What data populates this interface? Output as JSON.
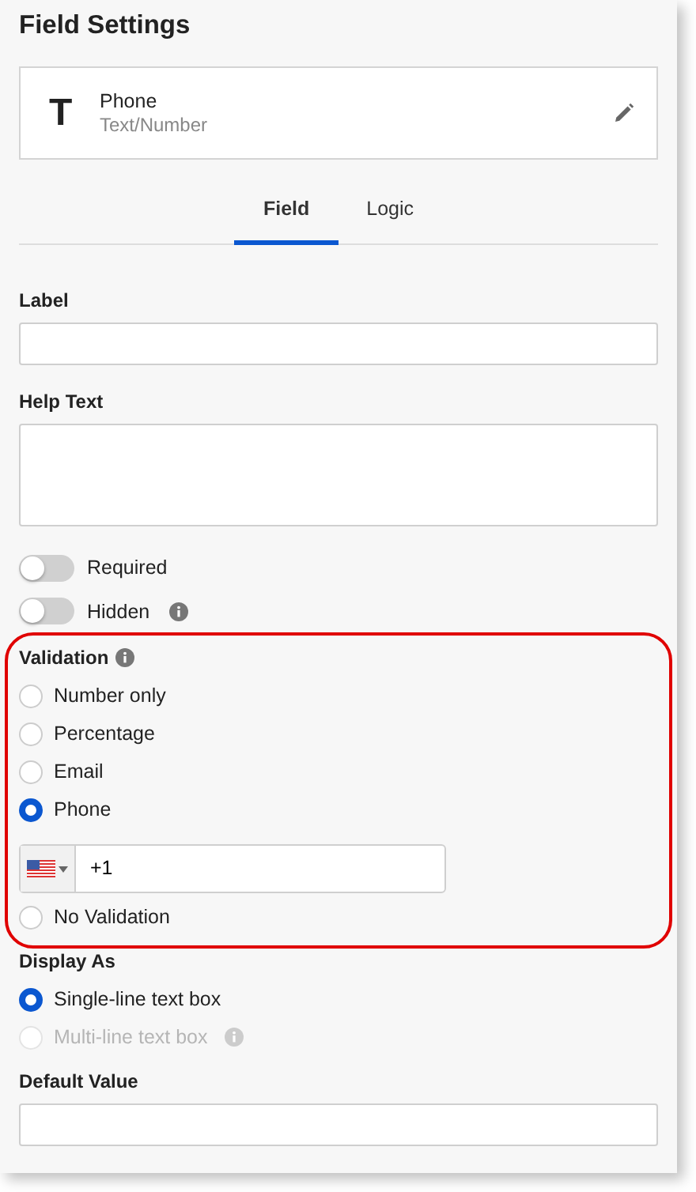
{
  "title": "Field Settings",
  "field_card": {
    "icon": "T",
    "name": "Phone",
    "type": "Text/Number"
  },
  "tabs": [
    {
      "label": "Field",
      "selected": true
    },
    {
      "label": "Logic",
      "selected": false
    }
  ],
  "fields": [
    {
      "label": "Label",
      "kind": "input"
    },
    {
      "label": "Help Text",
      "kind": "textarea"
    }
  ],
  "toggles": [
    {
      "label": "Required",
      "on": false,
      "info": false
    },
    {
      "label": "Hidden",
      "on": false,
      "info": true
    }
  ],
  "validation": {
    "label": "Validation",
    "info": true,
    "highlighted": true,
    "options": [
      {
        "label": "Number only",
        "selected": false,
        "kind": "plain"
      },
      {
        "label": "Percentage",
        "selected": false,
        "kind": "plain"
      },
      {
        "label": "Email",
        "selected": false,
        "kind": "plain"
      },
      {
        "label": "Phone",
        "selected": true,
        "kind": "phone"
      },
      {
        "label": "No Validation",
        "selected": false,
        "kind": "plain"
      }
    ],
    "phone_value": "+1"
  },
  "display_as": {
    "label": "Display As",
    "options": [
      {
        "label": "Single-line text box",
        "selected": true,
        "disabled": false,
        "info": false
      },
      {
        "label": "Multi-line text box",
        "selected": false,
        "disabled": true,
        "info": true
      }
    ]
  },
  "default_value": {
    "label": "Default Value"
  }
}
